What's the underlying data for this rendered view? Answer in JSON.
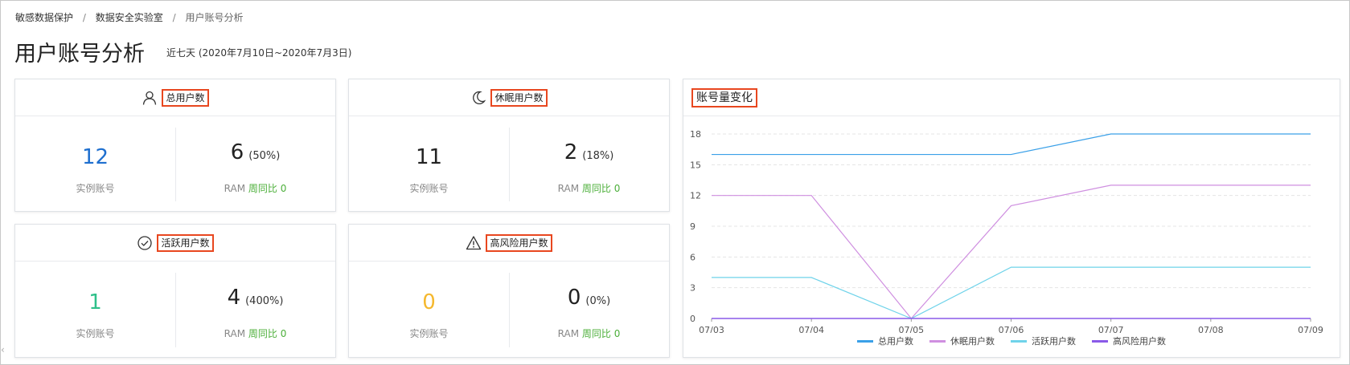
{
  "breadcrumb": {
    "item1": "敏感数据保护",
    "item2": "数据安全实验室",
    "current": "用户账号分析",
    "sep": "/"
  },
  "page": {
    "title": "用户账号分析",
    "subtitle": "近七天 (2020年7月10日~2020年7月3日)"
  },
  "cards": {
    "total": {
      "title": "总用户数",
      "left_value": "12",
      "left_label": "实例账号",
      "right_value": "6",
      "right_pct": "(50%)",
      "right_prefix": "RAM",
      "right_compare": "周同比 0"
    },
    "dormant": {
      "title": "休眠用户数",
      "left_value": "11",
      "left_label": "实例账号",
      "right_value": "2",
      "right_pct": "(18%)",
      "right_prefix": "RAM",
      "right_compare": "周同比 0"
    },
    "active": {
      "title": "活跃用户数",
      "left_value": "1",
      "left_label": "实例账号",
      "right_value": "4",
      "right_pct": "(400%)",
      "right_prefix": "RAM",
      "right_compare": "周同比 0"
    },
    "risky": {
      "title": "高风险用户数",
      "left_value": "0",
      "left_label": "实例账号",
      "right_value": "0",
      "right_pct": "(0%)",
      "right_prefix": "RAM",
      "right_compare": "周同比 0"
    }
  },
  "colors": {
    "blue_value": "#1e6fcf",
    "dark_value": "#222222",
    "green_value": "#2fc08a",
    "yellow_value": "#f5b82e",
    "compare_green": "#4caf3a",
    "highlight": "#e8471f"
  },
  "chart_data": {
    "type": "line",
    "title": "账号量变化",
    "categories": [
      "07/03",
      "07/04",
      "07/05",
      "07/06",
      "07/07",
      "07/08",
      "07/09"
    ],
    "y_ticks": [
      0,
      3,
      6,
      9,
      12,
      15,
      18
    ],
    "ylim": [
      0,
      18
    ],
    "grid": true,
    "legend_position": "bottom",
    "series": [
      {
        "name": "总用户数",
        "color": "#3aa0e8",
        "values": [
          16,
          16,
          16,
          16,
          18,
          18,
          18
        ]
      },
      {
        "name": "休眠用户数",
        "color": "#cf8fe0",
        "values": [
          12,
          12,
          0,
          11,
          13,
          13,
          13
        ]
      },
      {
        "name": "活跃用户数",
        "color": "#6fd3ea",
        "values": [
          4,
          4,
          0,
          5,
          5,
          5,
          5
        ]
      },
      {
        "name": "高风险用户数",
        "color": "#8a5ae8",
        "values": [
          0,
          0,
          0,
          0,
          0,
          0,
          0
        ]
      }
    ]
  }
}
